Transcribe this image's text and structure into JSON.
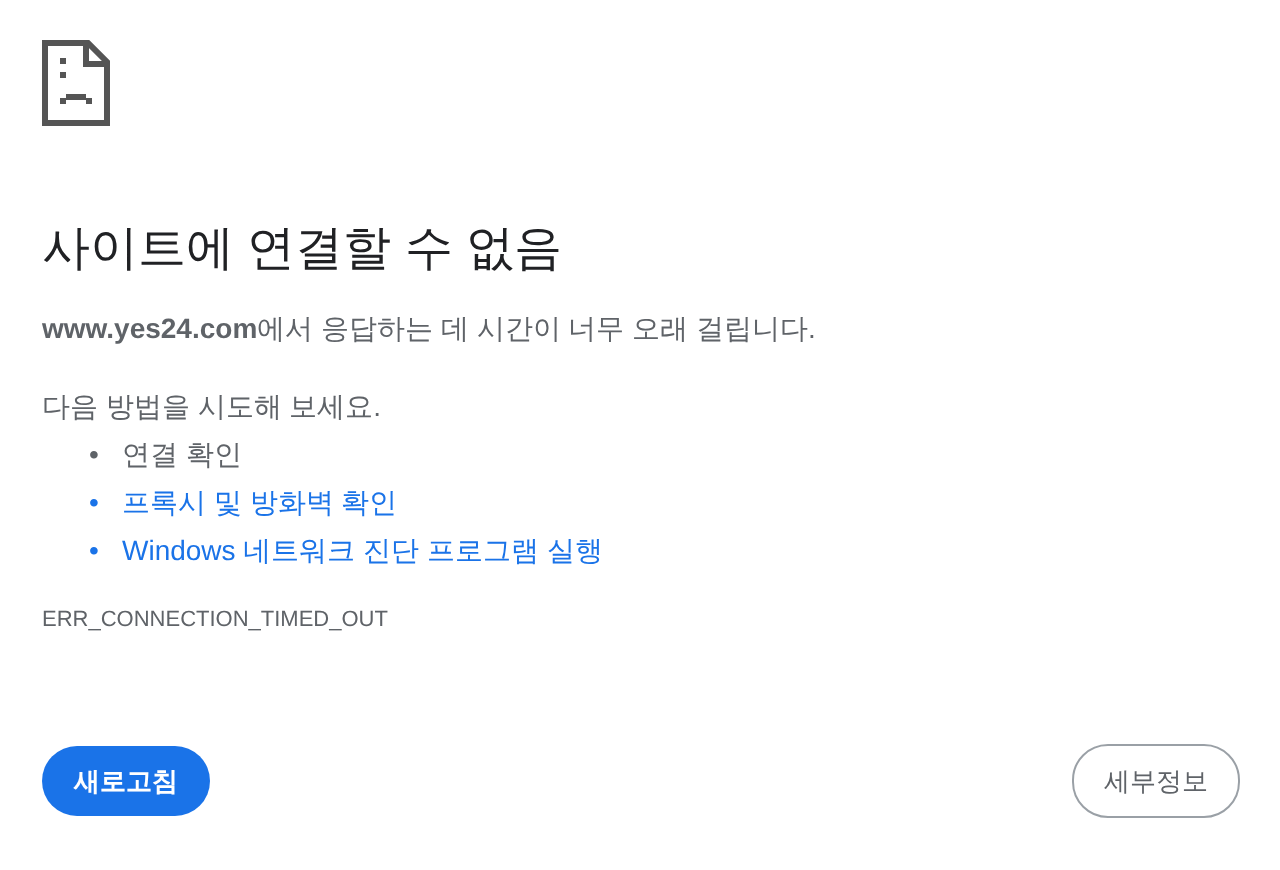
{
  "heading": "사이트에 연결할 수 없음",
  "summary": "**www.yes24.com**에서 응답하는 데 시간이 너무 오래 걸립니다.",
  "suggestions_intro": "다음 방법을 시도해 보세요.",
  "suggestions": [
    {
      "kind": "text",
      "bullet": "•",
      "label": "연결 확인"
    },
    {
      "kind": "link",
      "bullet": "•",
      "label": "프록시 및 방화벽 확인"
    },
    {
      "kind": "link",
      "bullet": "•",
      "label": "Windows 네트워크 진단 프로그램 실행"
    }
  ],
  "error_code": "ERR_CONNECTION_TIMED_OUT",
  "buttons": [
    {
      "kind": "primary",
      "label": "새로고침"
    },
    {
      "kind": "secondary",
      "label": "세부정보"
    }
  ]
}
